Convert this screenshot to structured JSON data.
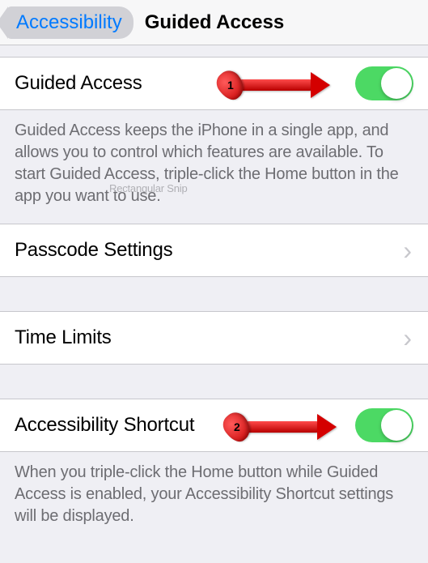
{
  "nav": {
    "back_label": "Accessibility",
    "title": "Guided Access"
  },
  "rows": {
    "guided_access": {
      "label": "Guided Access"
    },
    "passcode": {
      "label": "Passcode Settings"
    },
    "time_limits": {
      "label": "Time Limits"
    },
    "shortcut": {
      "label": "Accessibility Shortcut"
    }
  },
  "footers": {
    "guided_access": "Guided Access keeps the iPhone in a single app, and allows you to control which features are available. To start Guided Access, triple-click the Home button in the app you want to use.",
    "shortcut": "When you triple-click the Home button while Guided Access is enabled, your Accessibility Shortcut settings will be displayed."
  },
  "annotations": {
    "badge1": "1",
    "badge2": "2",
    "snip": "Rectangular Snip"
  },
  "colors": {
    "accent": "#007aff",
    "toggle_on": "#4cd964"
  }
}
